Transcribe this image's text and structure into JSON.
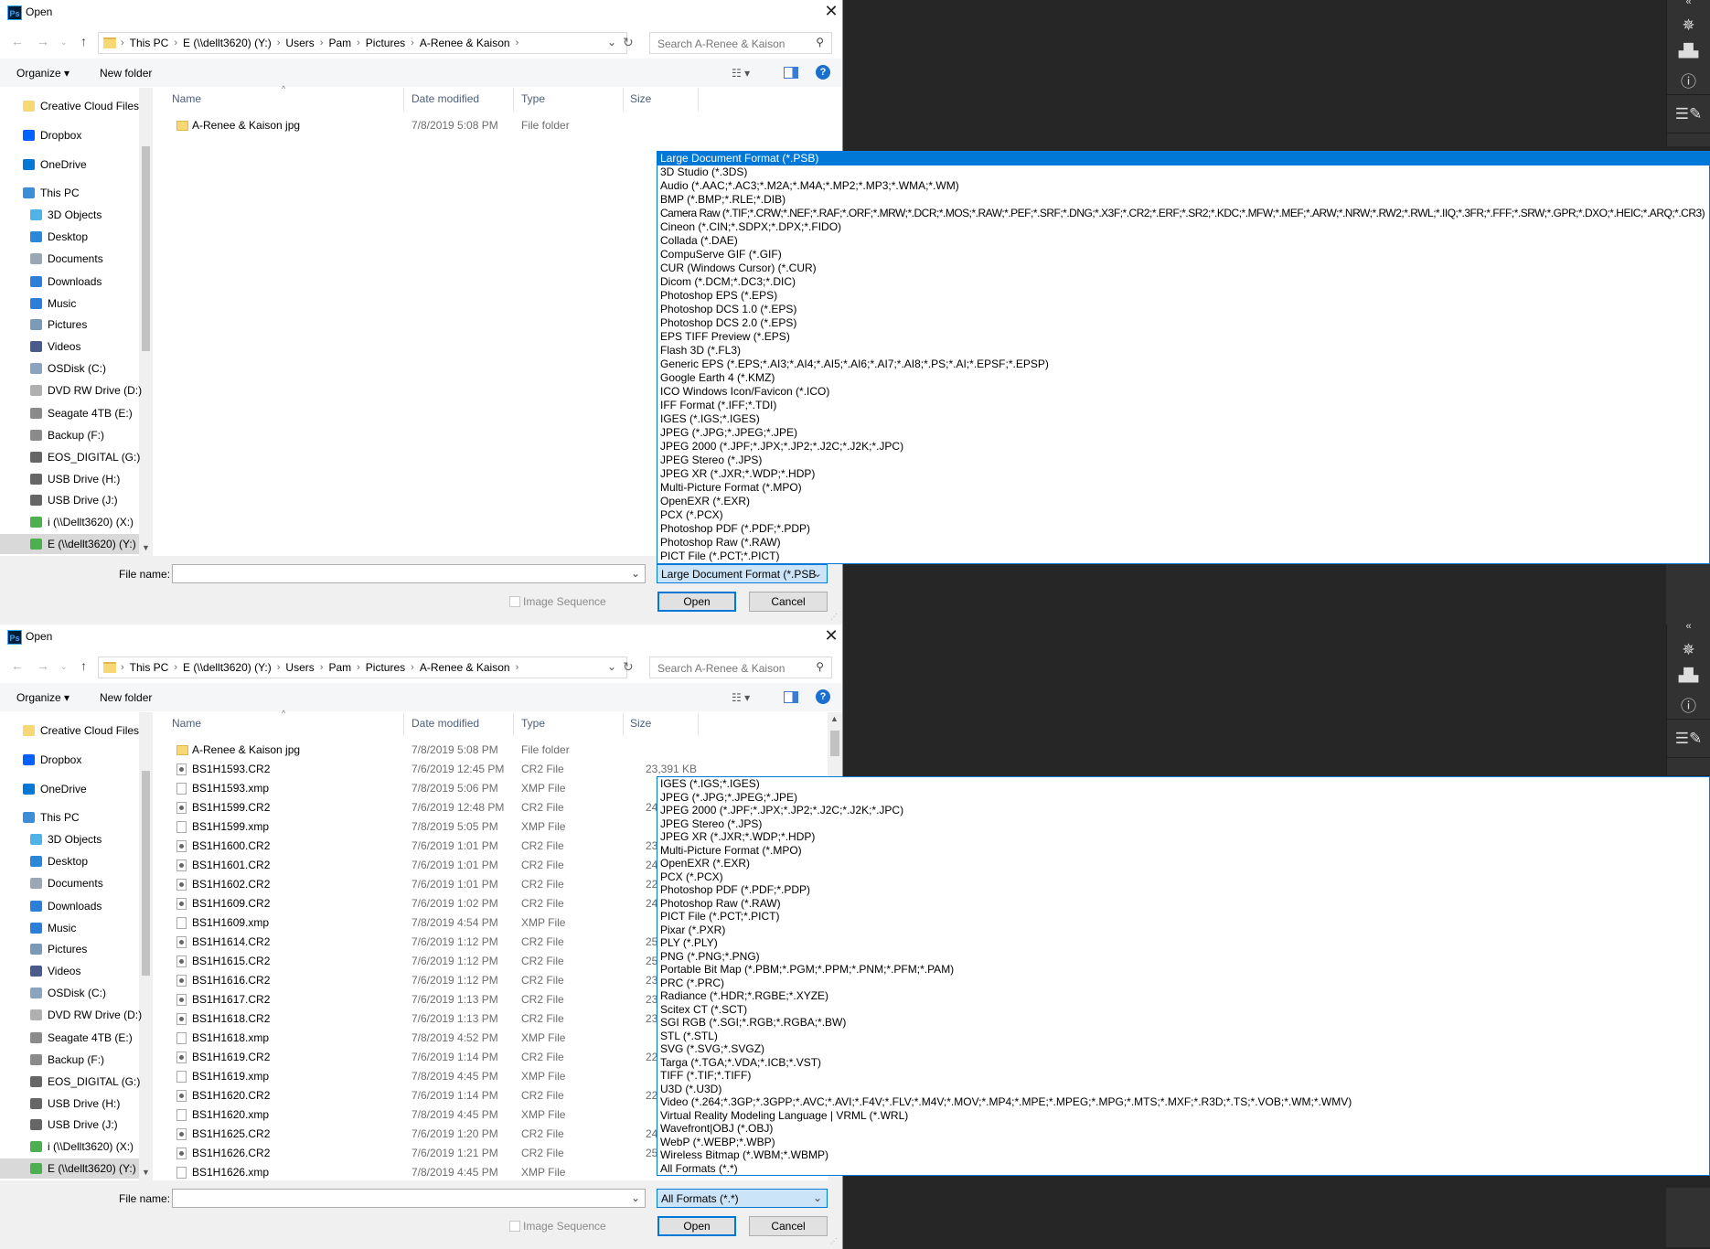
{
  "sidebar": [
    {
      "label": "Creative Cloud Files",
      "icon": "creative-cloud-icon",
      "color": "#f8d775",
      "level": 0
    },
    {
      "label": "Dropbox",
      "icon": "dropbox-icon",
      "color": "#0061fe",
      "level": 0
    },
    {
      "label": "OneDrive",
      "icon": "onedrive-icon",
      "color": "#0078d4",
      "level": 0
    },
    {
      "label": "This PC",
      "icon": "computer-icon",
      "color": "#3a8fd8",
      "level": 0
    },
    {
      "label": "3D Objects",
      "icon": "3d-objects-icon",
      "color": "#4fb3e8",
      "level": 1
    },
    {
      "label": "Desktop",
      "icon": "desktop-icon",
      "color": "#2b88d8",
      "level": 1
    },
    {
      "label": "Documents",
      "icon": "documents-icon",
      "color": "#9aa7b5",
      "level": 1
    },
    {
      "label": "Downloads",
      "icon": "downloads-icon",
      "color": "#2b7fd8",
      "level": 1
    },
    {
      "label": "Music",
      "icon": "music-icon",
      "color": "#2b7fd8",
      "level": 1
    },
    {
      "label": "Pictures",
      "icon": "pictures-icon",
      "color": "#7a9ab8",
      "level": 1
    },
    {
      "label": "Videos",
      "icon": "videos-icon",
      "color": "#4a5a8a",
      "level": 1
    },
    {
      "label": "OSDisk (C:)",
      "icon": "drive-icon",
      "color": "#8aa4bf",
      "level": 1
    },
    {
      "label": "DVD RW Drive (D:)",
      "icon": "dvd-drive-icon",
      "color": "#b0b0b0",
      "level": 1
    },
    {
      "label": "Seagate 4TB (E:)",
      "icon": "drive-icon",
      "color": "#8a8a8a",
      "level": 1
    },
    {
      "label": "Backup (F:)",
      "icon": "drive-icon",
      "color": "#8a8a8a",
      "level": 1
    },
    {
      "label": "EOS_DIGITAL (G:)",
      "icon": "usb-drive-icon",
      "color": "#666",
      "level": 1
    },
    {
      "label": "USB Drive (H:)",
      "icon": "usb-drive-icon",
      "color": "#666",
      "level": 1
    },
    {
      "label": "USB Drive (J:)",
      "icon": "usb-drive-icon",
      "color": "#666",
      "level": 1
    },
    {
      "label": "i (\\\\Dellt3620) (X:)",
      "icon": "network-drive-icon",
      "color": "#4caf50",
      "level": 1
    },
    {
      "label": "E (\\\\dellt3620) (Y:)",
      "icon": "network-drive-icon",
      "color": "#4caf50",
      "level": 1,
      "selected": true
    }
  ],
  "dialogs": [
    {
      "title": "Open",
      "path": [
        "This PC",
        "E (\\\\dellt3620) (Y:)",
        "Users",
        "Pam",
        "Pictures",
        "A-Renee & Kaison"
      ],
      "search_placeholder": "Search A-Renee & Kaison",
      "toolbar": {
        "organize": "Organize ▾",
        "new_folder": "New folder"
      },
      "columns": [
        "Name",
        "Date modified",
        "Type",
        "Size"
      ],
      "files": [
        {
          "name": "A-Renee & Kaison jpg",
          "date": "7/8/2019 5:08 PM",
          "type": "File folder",
          "size": "",
          "icon": "folder"
        }
      ],
      "footer": {
        "file_name_label": "File name:",
        "file_name_value": "",
        "file_type": "Large Document Format (*.PSB",
        "image_sequence": "Image Sequence",
        "open": "Open",
        "cancel": "Cancel"
      },
      "dropdown": {
        "highlighted": 0,
        "items": [
          "Large Document Format (*.PSB)",
          "3D Studio (*.3DS)",
          "Audio (*.AAC;*.AC3;*.M2A;*.M4A;*.MP2;*.MP3;*.WMA;*.WM)",
          "BMP (*.BMP;*.RLE;*.DIB)",
          "Camera Raw (*.TIF;*.CRW;*.NEF;*.RAF;*.ORF;*.MRW;*.DCR;*.MOS;*.RAW;*.PEF;*.SRF;*.DNG;*.X3F;*.CR2;*.ERF;*.SR2;*.KDC;*.MFW;*.MEF;*.ARW;*.NRW;*.RW2;*.RWL;*.IIQ;*.3FR;*.FFF;*.SRW;*.GPR;*.DXO;*.HEIC;*.ARQ;*.CR3)",
          "Cineon (*.CIN;*.SDPX;*.DPX;*.FIDO)",
          "Collada (*.DAE)",
          "CompuServe GIF (*.GIF)",
          "CUR (Windows Cursor) (*.CUR)",
          "Dicom (*.DCM;*.DC3;*.DIC)",
          "Photoshop EPS (*.EPS)",
          "Photoshop DCS 1.0 (*.EPS)",
          "Photoshop DCS 2.0 (*.EPS)",
          "EPS TIFF Preview (*.EPS)",
          "Flash 3D (*.FL3)",
          "Generic EPS (*.EPS;*.AI3;*.AI4;*.AI5;*.AI6;*.AI7;*.AI8;*.PS;*.AI;*.EPSF;*.EPSP)",
          "Google Earth 4 (*.KMZ)",
          "ICO Windows Icon/Favicon (*.ICO)",
          "IFF Format (*.IFF;*.TDI)",
          "IGES (*.IGS;*.IGES)",
          "JPEG (*.JPG;*.JPEG;*.JPE)",
          "JPEG 2000 (*.JPF;*.JPX;*.JP2;*.J2C;*.J2K;*.JPC)",
          "JPEG Stereo (*.JPS)",
          "JPEG XR (*.JXR;*.WDP;*.HDP)",
          "Multi-Picture Format (*.MPO)",
          "OpenEXR (*.EXR)",
          "PCX (*.PCX)",
          "Photoshop PDF (*.PDF;*.PDP)",
          "Photoshop Raw (*.RAW)",
          "PICT File (*.PCT;*.PICT)"
        ]
      }
    },
    {
      "title": "Open",
      "path": [
        "This PC",
        "E (\\\\dellt3620) (Y:)",
        "Users",
        "Pam",
        "Pictures",
        "A-Renee & Kaison"
      ],
      "search_placeholder": "Search A-Renee & Kaison",
      "toolbar": {
        "organize": "Organize ▾",
        "new_folder": "New folder"
      },
      "columns": [
        "Name",
        "Date modified",
        "Type",
        "Size"
      ],
      "files": [
        {
          "name": "A-Renee & Kaison jpg",
          "date": "7/8/2019 5:08 PM",
          "type": "File folder",
          "size": "",
          "icon": "folder"
        },
        {
          "name": "BS1H1593.CR2",
          "date": "7/6/2019 12:45 PM",
          "type": "CR2 File",
          "size": "23,391 KB",
          "icon": "cr2"
        },
        {
          "name": "BS1H1593.xmp",
          "date": "7/8/2019 5:06 PM",
          "type": "XMP File",
          "size": "",
          "icon": "xmp"
        },
        {
          "name": "BS1H1599.CR2",
          "date": "7/6/2019 12:48 PM",
          "type": "CR2 File",
          "size": "24",
          "icon": "cr2"
        },
        {
          "name": "BS1H1599.xmp",
          "date": "7/8/2019 5:05 PM",
          "type": "XMP File",
          "size": "",
          "icon": "xmp"
        },
        {
          "name": "BS1H1600.CR2",
          "date": "7/6/2019 1:01 PM",
          "type": "CR2 File",
          "size": "23",
          "icon": "cr2"
        },
        {
          "name": "BS1H1601.CR2",
          "date": "7/6/2019 1:01 PM",
          "type": "CR2 File",
          "size": "24",
          "icon": "cr2"
        },
        {
          "name": "BS1H1602.CR2",
          "date": "7/6/2019 1:01 PM",
          "type": "CR2 File",
          "size": "22",
          "icon": "cr2"
        },
        {
          "name": "BS1H1609.CR2",
          "date": "7/6/2019 1:02 PM",
          "type": "CR2 File",
          "size": "24",
          "icon": "cr2"
        },
        {
          "name": "BS1H1609.xmp",
          "date": "7/8/2019 4:54 PM",
          "type": "XMP File",
          "size": "",
          "icon": "xmp"
        },
        {
          "name": "BS1H1614.CR2",
          "date": "7/6/2019 1:12 PM",
          "type": "CR2 File",
          "size": "25",
          "icon": "cr2"
        },
        {
          "name": "BS1H1615.CR2",
          "date": "7/6/2019 1:12 PM",
          "type": "CR2 File",
          "size": "25",
          "icon": "cr2"
        },
        {
          "name": "BS1H1616.CR2",
          "date": "7/6/2019 1:12 PM",
          "type": "CR2 File",
          "size": "23",
          "icon": "cr2"
        },
        {
          "name": "BS1H1617.CR2",
          "date": "7/6/2019 1:13 PM",
          "type": "CR2 File",
          "size": "23",
          "icon": "cr2"
        },
        {
          "name": "BS1H1618.CR2",
          "date": "7/6/2019 1:13 PM",
          "type": "CR2 File",
          "size": "23",
          "icon": "cr2"
        },
        {
          "name": "BS1H1618.xmp",
          "date": "7/8/2019 4:52 PM",
          "type": "XMP File",
          "size": "",
          "icon": "xmp"
        },
        {
          "name": "BS1H1619.CR2",
          "date": "7/6/2019 1:14 PM",
          "type": "CR2 File",
          "size": "22",
          "icon": "cr2"
        },
        {
          "name": "BS1H1619.xmp",
          "date": "7/8/2019 4:45 PM",
          "type": "XMP File",
          "size": "",
          "icon": "xmp"
        },
        {
          "name": "BS1H1620.CR2",
          "date": "7/6/2019 1:14 PM",
          "type": "CR2 File",
          "size": "22",
          "icon": "cr2"
        },
        {
          "name": "BS1H1620.xmp",
          "date": "7/8/2019 4:45 PM",
          "type": "XMP File",
          "size": "",
          "icon": "xmp"
        },
        {
          "name": "BS1H1625.CR2",
          "date": "7/6/2019 1:20 PM",
          "type": "CR2 File",
          "size": "24",
          "icon": "cr2"
        },
        {
          "name": "BS1H1626.CR2",
          "date": "7/6/2019 1:21 PM",
          "type": "CR2 File",
          "size": "25",
          "icon": "cr2"
        },
        {
          "name": "BS1H1626.xmp",
          "date": "7/8/2019 4:45 PM",
          "type": "XMP File",
          "size": "",
          "icon": "xmp"
        }
      ],
      "footer": {
        "file_name_label": "File name:",
        "file_name_value": "",
        "file_type": "All Formats (*.*)",
        "image_sequence": "Image Sequence",
        "open": "Open",
        "cancel": "Cancel"
      },
      "dropdown": {
        "highlighted": 30,
        "items": [
          "IGES (*.IGS;*.IGES)",
          "JPEG (*.JPG;*.JPEG;*.JPE)",
          "JPEG 2000 (*.JPF;*.JPX;*.JP2;*.J2C;*.J2K;*.JPC)",
          "JPEG Stereo (*.JPS)",
          "JPEG XR (*.JXR;*.WDP;*.HDP)",
          "Multi-Picture Format (*.MPO)",
          "OpenEXR (*.EXR)",
          "PCX (*.PCX)",
          "Photoshop PDF (*.PDF;*.PDP)",
          "Photoshop Raw (*.RAW)",
          "PICT File (*.PCT;*.PICT)",
          "Pixar (*.PXR)",
          "PLY (*.PLY)",
          "PNG (*.PNG;*.PNG)",
          "Portable Bit Map (*.PBM;*.PGM;*.PPM;*.PNM;*.PFM;*.PAM)",
          "PRC (*.PRC)",
          "Radiance (*.HDR;*.RGBE;*.XYZE)",
          "Scitex CT (*.SCT)",
          "SGI RGB (*.SGI;*.RGB;*.RGBA;*.BW)",
          "STL (*.STL)",
          "SVG (*.SVG;*.SVGZ)",
          "Targa (*.TGA;*.VDA;*.ICB;*.VST)",
          "TIFF (*.TIF;*.TIFF)",
          "U3D (*.U3D)",
          "Video (*.264;*.3GP;*.3GPP;*.AVC;*.AVI;*.F4V;*.FLV;*.M4V;*.MOV;*.MP4;*.MPE;*.MPEG;*.MPG;*.MTS;*.MXF;*.R3D;*.TS;*.VOB;*.WM;*.WMV)",
          "Virtual Reality Modeling Language | VRML (*.WRL)",
          "Wavefront|OBJ (*.OBJ)",
          "WebP (*.WEBP;*.WBP)",
          "Wireless Bitmap (*.WBM;*.WBMP)",
          "All Formats (*.*)"
        ]
      }
    }
  ],
  "photoshop_panel": {
    "icons": [
      "navigator-icon",
      "histogram-icon",
      "info-icon",
      "brush-presets-icon"
    ]
  }
}
